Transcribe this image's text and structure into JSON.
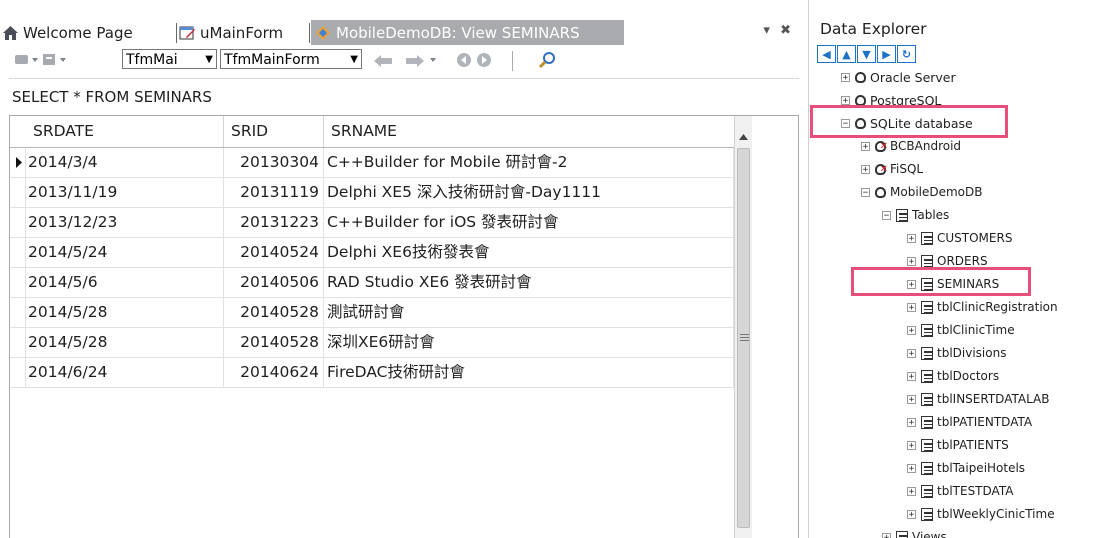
{
  "tabs": [
    {
      "label": "Welcome Page",
      "icon": "home-icon",
      "active": false
    },
    {
      "label": "uMainForm",
      "icon": "form-icon",
      "active": false
    },
    {
      "label": "MobileDemoDB: View SEMINARS",
      "icon": "database-view-icon",
      "active": true
    }
  ],
  "pane_controls": {
    "pin": "▾",
    "close": "✖"
  },
  "toolbar": {
    "combo1": "TfmMai",
    "combo2": "TfmMainForm"
  },
  "query": "SELECT * FROM SEMINARS",
  "grid": {
    "columns": [
      "SRDATE",
      "SRID",
      "SRNAME"
    ],
    "rows": [
      {
        "date": "2014/3/4",
        "id": "20130304",
        "name": "C++Builder for Mobile 研討會-2",
        "current": true
      },
      {
        "date": "2013/11/19",
        "id": "20131119",
        "name": "Delphi XE5 深入技術研討會-Day1111",
        "current": false
      },
      {
        "date": "2013/12/23",
        "id": "20131223",
        "name": "C++Builder for iOS 發表研討會",
        "current": false
      },
      {
        "date": "2014/5/24",
        "id": "20140524",
        "name": "Delphi XE6技術發表會",
        "current": false
      },
      {
        "date": "2014/5/6",
        "id": "20140506",
        "name": "RAD Studio XE6 發表研討會",
        "current": false
      },
      {
        "date": "2014/5/28",
        "id": "20140528",
        "name": "測試研討會",
        "current": false
      },
      {
        "date": "2014/5/28",
        "id": "20140528",
        "name": "深圳XE6研討會",
        "current": false
      },
      {
        "date": "2014/6/24",
        "id": "20140624",
        "name": "FireDAC技術研討會",
        "current": false
      }
    ]
  },
  "explorer": {
    "title": "Data Explorer",
    "nav": [
      "◀",
      "▲",
      "▼",
      "▶",
      "↻"
    ],
    "tree": [
      {
        "label": "Oracle Server",
        "level": 0,
        "expander": "+",
        "icon": "database-icon"
      },
      {
        "label": "PostgreSQL",
        "level": 0,
        "expander": "+",
        "icon": "database-icon"
      },
      {
        "label": "SQLite database",
        "level": 0,
        "expander": "−",
        "icon": "database-icon",
        "highlight": true
      },
      {
        "label": "BCBAndroid",
        "level": 1,
        "expander": "+",
        "icon": "connection-error-icon"
      },
      {
        "label": "FiSQL",
        "level": 1,
        "expander": "+",
        "icon": "connection-error-icon"
      },
      {
        "label": "MobileDemoDB",
        "level": 1,
        "expander": "−",
        "icon": "connection-icon"
      },
      {
        "label": "Tables",
        "level": 2,
        "expander": "−",
        "icon": "tables-folder-icon"
      },
      {
        "label": "CUSTOMERS",
        "level": 3,
        "expander": "+",
        "icon": "table-icon"
      },
      {
        "label": "ORDERS",
        "level": 3,
        "expander": "+",
        "icon": "table-icon"
      },
      {
        "label": "SEMINARS",
        "level": 3,
        "expander": "+",
        "icon": "table-icon",
        "highlight": true
      },
      {
        "label": "tblClinicRegistration",
        "level": 3,
        "expander": "+",
        "icon": "table-icon"
      },
      {
        "label": "tblClinicTime",
        "level": 3,
        "expander": "+",
        "icon": "table-icon"
      },
      {
        "label": "tblDivisions",
        "level": 3,
        "expander": "+",
        "icon": "table-icon"
      },
      {
        "label": "tblDoctors",
        "level": 3,
        "expander": "+",
        "icon": "table-icon"
      },
      {
        "label": "tblINSERTDATALAB",
        "level": 3,
        "expander": "+",
        "icon": "table-icon"
      },
      {
        "label": "tblPATIENTDATA",
        "level": 3,
        "expander": "+",
        "icon": "table-icon"
      },
      {
        "label": "tblPATIENTS",
        "level": 3,
        "expander": "+",
        "icon": "table-icon"
      },
      {
        "label": "tblTaipeiHotels",
        "level": 3,
        "expander": "+",
        "icon": "table-icon"
      },
      {
        "label": "tblTESTDATA",
        "level": 3,
        "expander": "+",
        "icon": "table-icon"
      },
      {
        "label": "tblWeeklyCinicTime",
        "level": 3,
        "expander": "+",
        "icon": "table-icon"
      },
      {
        "label": "Views",
        "level": 2,
        "expander": "+",
        "icon": "views-folder-icon"
      }
    ]
  },
  "colors": {
    "active_tab": "#a9abaf",
    "highlight": "#e74f7a",
    "nav_blue": "#1e73c8"
  }
}
